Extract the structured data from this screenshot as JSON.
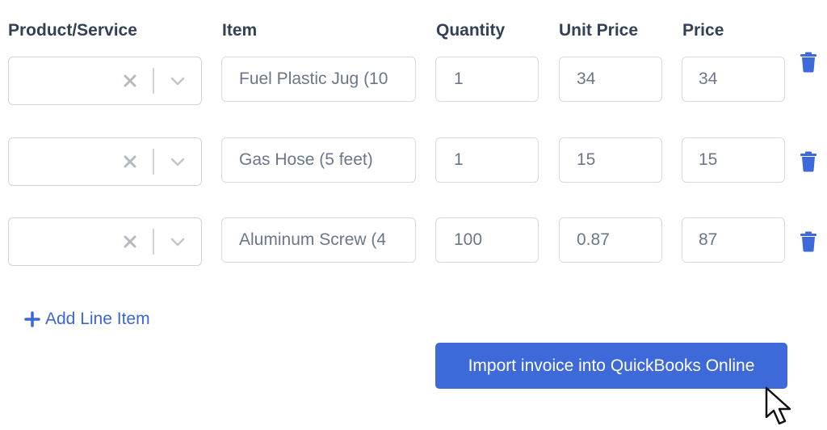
{
  "headers": {
    "product_service": "Product/Service",
    "item": "Item",
    "quantity": "Quantity",
    "unit_price": "Unit Price",
    "price": "Price"
  },
  "line_items": [
    {
      "product_service": "",
      "item": "Fuel Plastic Jug (10",
      "quantity": "1",
      "unit_price": "34",
      "price": "34"
    },
    {
      "product_service": "",
      "item": "Gas Hose (5 feet)",
      "quantity": "1",
      "unit_price": "15",
      "price": "15"
    },
    {
      "product_service": "",
      "item": "Aluminum Screw (4",
      "quantity": "100",
      "unit_price": "0.87",
      "price": "87"
    }
  ],
  "actions": {
    "add_line_item": "Add Line Item",
    "import_invoice": "Import invoice into QuickBooks Online"
  },
  "icons": {
    "clear": "close-icon",
    "dropdown": "chevron-down-icon",
    "delete": "trash-icon",
    "add": "plus-icon",
    "pointer": "mouse-pointer-icon"
  },
  "colors": {
    "accent": "#3d6ad8",
    "link": "#3b66d6",
    "header_text": "#334155",
    "field_text": "#6b7689",
    "border": "#d5d9df"
  }
}
